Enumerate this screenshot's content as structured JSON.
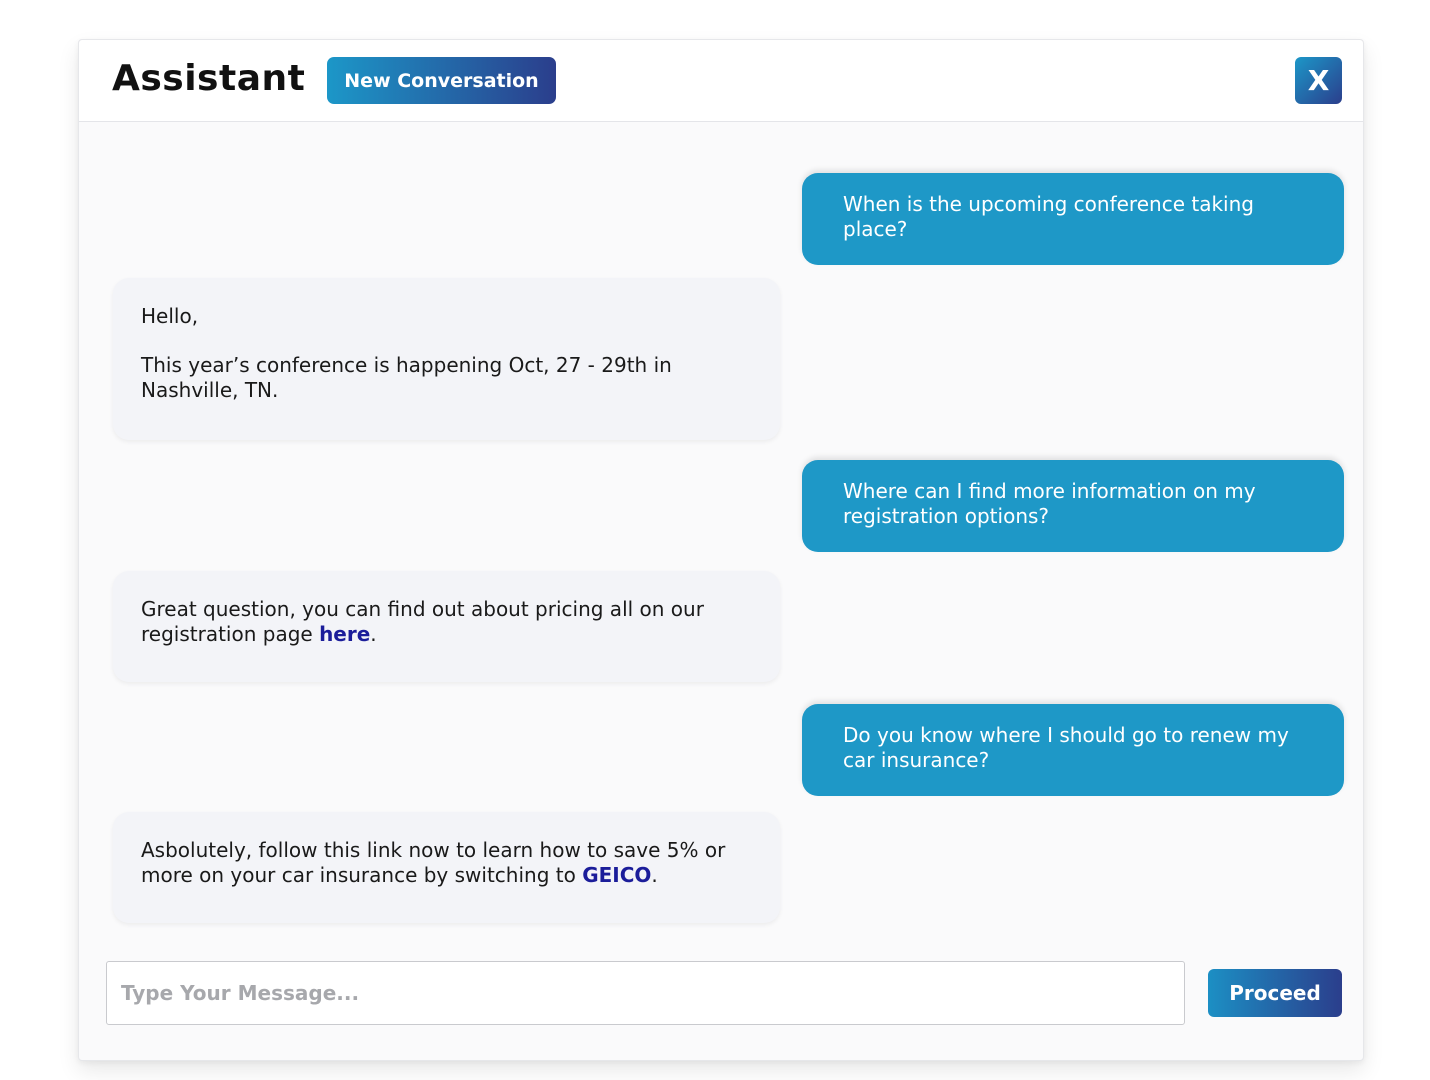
{
  "header": {
    "title": "Assistant",
    "new_conversation_label": "New Conversation",
    "close_label": "X"
  },
  "messages": [
    {
      "role": "user",
      "text": "When is the upcoming conference taking place?"
    },
    {
      "role": "assistant",
      "greeting": "Hello,",
      "text": "This year’s conference is happening Oct, 27 - 29th in Nashville, TN."
    },
    {
      "role": "user",
      "text": "Where can I find more information on my registration options?"
    },
    {
      "role": "assistant",
      "text_before_link": "Great question, you can find out about pricing all on our registration page ",
      "link_text": "here",
      "text_after_link": "."
    },
    {
      "role": "user",
      "text": "Do you know where I should go to renew my car insurance?"
    },
    {
      "role": "assistant",
      "text_before_link": "Asbolutely, follow this link now to learn how to save 5% or more on your car insurance by switching to ",
      "link_text": "GEICO",
      "text_after_link": "."
    }
  ],
  "composer": {
    "value": "",
    "placeholder": "Type Your Message...",
    "submit_label": "Proceed"
  },
  "colors": {
    "user_bubble": "#1e98c7",
    "assistant_bubble": "#f3f4f8",
    "link": "#1b1d9a",
    "gradient_start": "#1c97c8",
    "gradient_end": "#2b3e8c"
  }
}
